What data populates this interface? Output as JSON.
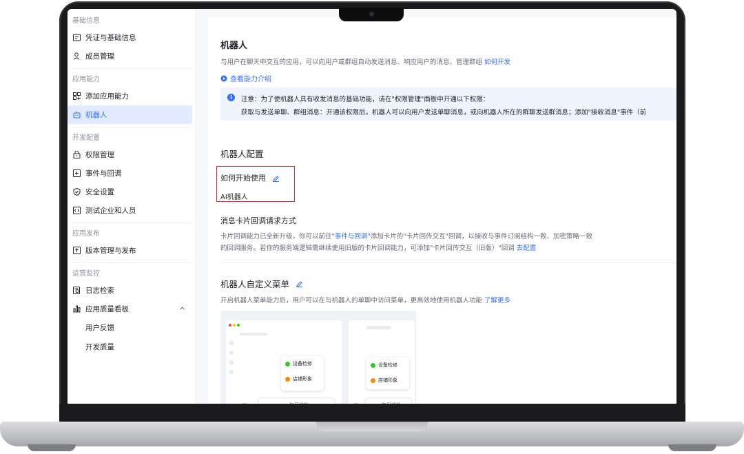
{
  "sidebar": {
    "sections": [
      {
        "title": "基础信息",
        "items": [
          {
            "label": "凭证与基础信息",
            "icon": "credential-icon"
          },
          {
            "label": "成员管理",
            "icon": "member-icon"
          }
        ]
      },
      {
        "title": "应用能力",
        "items": [
          {
            "label": "添加应用能力",
            "icon": "apps-icon"
          },
          {
            "label": "机器人",
            "icon": "robot-icon",
            "active": true
          }
        ]
      },
      {
        "title": "开发配置",
        "items": [
          {
            "label": "权限管理",
            "icon": "lock-icon"
          },
          {
            "label": "事件与回调",
            "icon": "event-icon"
          },
          {
            "label": "安全设置",
            "icon": "shield-icon"
          },
          {
            "label": "测试企业和人员",
            "icon": "test-icon"
          }
        ]
      },
      {
        "title": "应用发布",
        "items": [
          {
            "label": "版本管理与发布",
            "icon": "upload-icon"
          }
        ]
      },
      {
        "title": "运营监控",
        "items": [
          {
            "label": "日志检索",
            "icon": "log-icon"
          },
          {
            "label": "应用质量看板",
            "icon": "chart-icon"
          }
        ]
      }
    ],
    "sub_items": [
      "用户反馈",
      "开发质量"
    ]
  },
  "main": {
    "title": "机器人",
    "description": "与用户在聊天中交互的应用，可以向用户或群组自动发送消息、响应用户的消息、管理群组",
    "how_to_link": "如何开发",
    "view_capabilities": "查看能力介绍",
    "notice_line1": "注意：为了使机器人具有收发消息的基础功能，请在\"权限管理\"面板中开通以下权限：",
    "notice_line2": "获取与发送单聊、群组消息：开通该权限后，机器人可以向用户发送单聊消息，或向机器人所在的群聊发送群消息；添加\"接收消息\"事件（前",
    "config_title": "机器人配置",
    "howto_label": "如何开始使用",
    "howto_value": "AI机器人",
    "card_title": "消息卡片回调请求方式",
    "card_p1_a": "卡片回调能力已全新升级，你可以前往",
    "card_p1_link": "\"事件与回调\"",
    "card_p1_b": "添加卡片的\"卡片回传交互\"回调，以接收与事件订阅结构一致、加密策略一致",
    "card_p2": "的回调服务。若你的服务端逻辑需继续使用旧版的卡片回调能力，可添加\"卡片回传交互（旧版）\"回调",
    "card_p2_link": "去配置",
    "menu_title": "机器人自定义菜单",
    "menu_desc": "开启机器人菜单能力后，用户可以在与机器人的单聊中访问菜单，更高效地使用机器人功能",
    "menu_link": "了解更多",
    "illus": {
      "item1": "设备检修",
      "item2": "店铺形象",
      "bar": "≡ 每日巡检"
    }
  },
  "colors": {
    "accent": "#3370ff",
    "highlight_border": "#d9343a"
  }
}
